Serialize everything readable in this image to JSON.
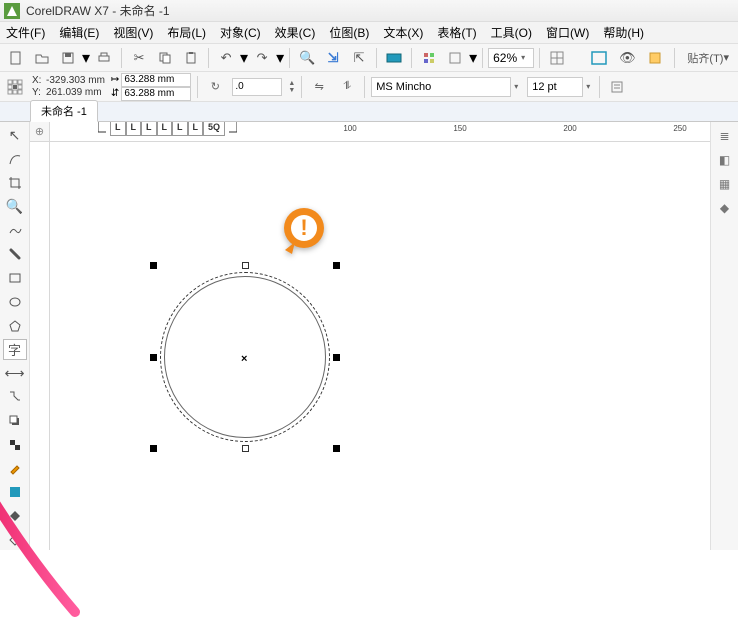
{
  "app": {
    "title": "CorelDRAW X7 - 未命名 -1"
  },
  "menu": {
    "file": "文件(F)",
    "edit": "编辑(E)",
    "view": "视图(V)",
    "layout": "布局(L)",
    "object": "对象(C)",
    "effects": "效果(C)",
    "bitmap": "位图(B)",
    "text": "文本(X)",
    "table": "表格(T)",
    "tools": "工具(O)",
    "window": "窗口(W)",
    "help": "帮助(H)"
  },
  "toolbar": {
    "zoom_value": "62%",
    "align_label": "贴齐(T)"
  },
  "properties": {
    "x_label": "X:",
    "x_value": "-329.303 mm",
    "y_label": "Y:",
    "y_value": "261.039 mm",
    "w_value": "63.288 mm",
    "h_value": "63.288 mm",
    "rotation": ".0",
    "font_name": "MS Mincho",
    "font_size": "12 pt"
  },
  "tabs": {
    "doc": "未命名 -1"
  },
  "ruler": {
    "h_marks": [
      "100",
      "150",
      "200",
      "250"
    ],
    "pagemarks": [
      "L",
      "L",
      "L",
      "L",
      "L",
      "L",
      "5Q"
    ]
  },
  "canvas": {
    "center_mark": "×"
  },
  "tools": {
    "pick": "↖",
    "shape": "✎",
    "crop": "✂",
    "zoom": "🔍",
    "freehand": "✏",
    "rect": "▭",
    "ellipse": "◯",
    "polygon": "⬠",
    "text_glyph": "字",
    "dimension": "↔",
    "connector": "↘",
    "interactive": "◆",
    "eyedrop": "✎",
    "outline": "◼",
    "fill": "◆"
  },
  "callout_icon": "!"
}
